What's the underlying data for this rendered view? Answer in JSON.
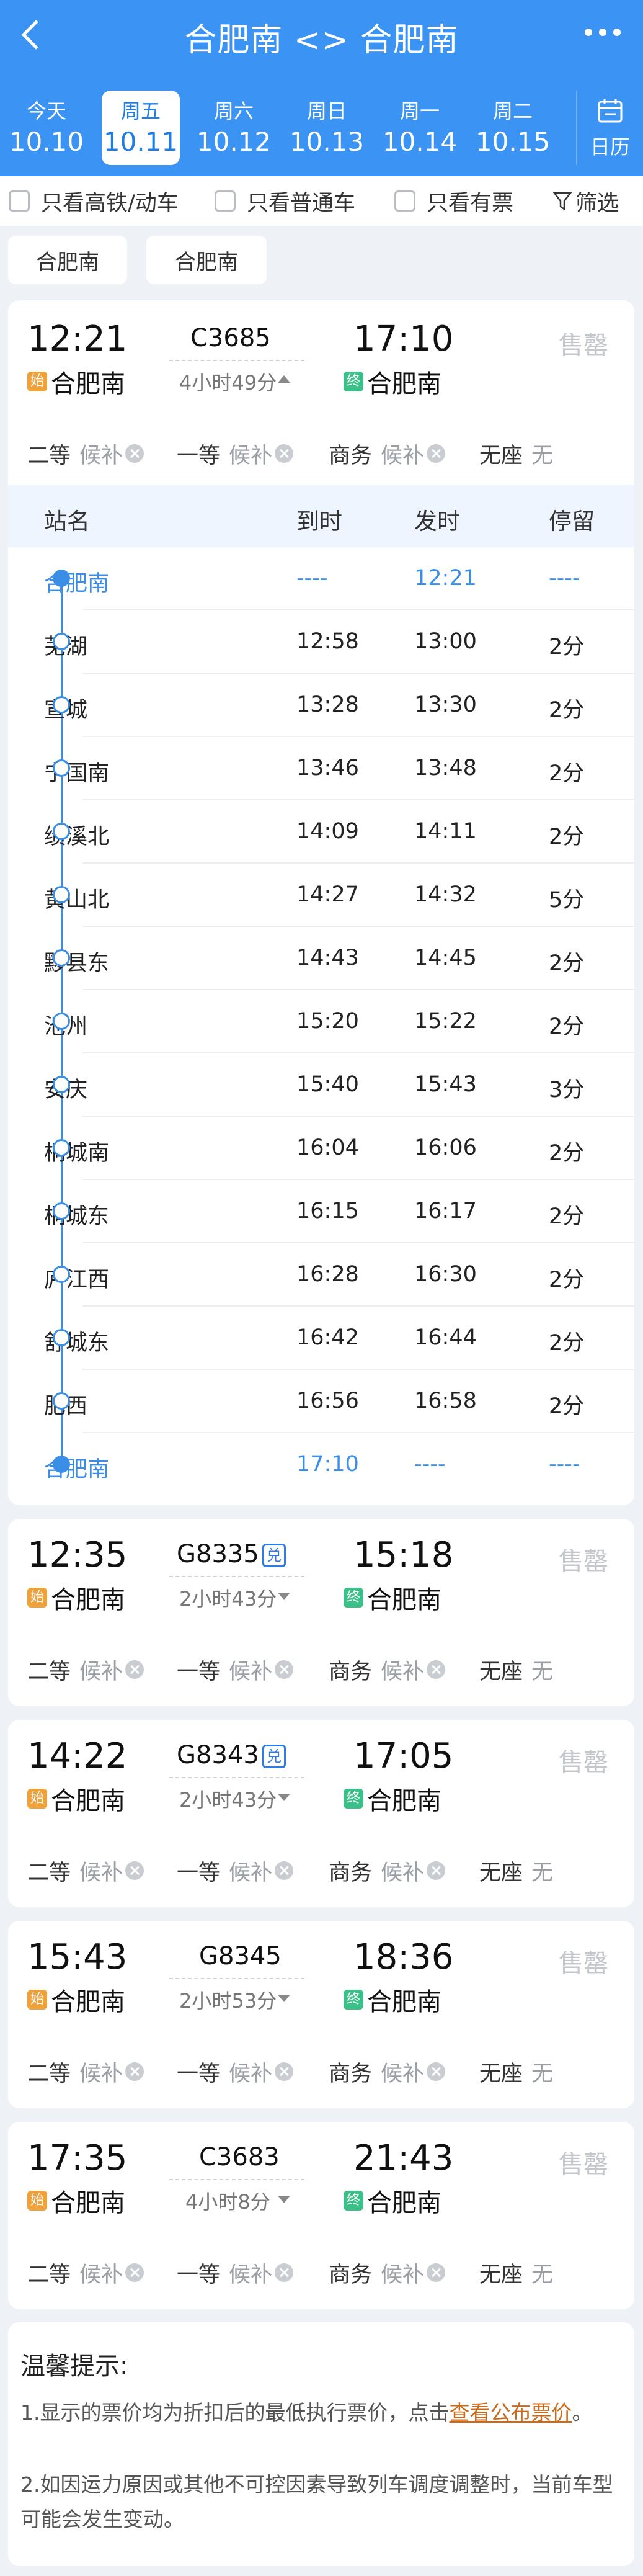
{
  "header": {
    "title": "合肥南 <> 合肥南",
    "back_icon": "chevron-left-icon",
    "more_icon": "more-dots-icon"
  },
  "dates": [
    {
      "weekday": "今天",
      "date": "10.10",
      "active": false
    },
    {
      "weekday": "周五",
      "date": "10.11",
      "active": true
    },
    {
      "weekday": "周六",
      "date": "10.12",
      "active": false
    },
    {
      "weekday": "周日",
      "date": "10.13",
      "active": false
    },
    {
      "weekday": "周一",
      "date": "10.14",
      "active": false
    },
    {
      "weekday": "周二",
      "date": "10.15",
      "active": false
    }
  ],
  "calendar": {
    "label": "日历",
    "icon": "calendar-icon"
  },
  "filters": {
    "high_speed": "只看高铁/动车",
    "regular": "只看普通车",
    "available": "只看有票",
    "filter": "筛选",
    "filter_icon": "funnel-icon"
  },
  "station_chips": {
    "from": "合肥南",
    "to": "合肥南"
  },
  "colors": {
    "primary": "#3b93f3",
    "line_blue": "#3b8ee6",
    "origin_badge": "#f0a23a",
    "terminal_badge": "#3cc08a",
    "link": "#c86a1c"
  },
  "trains": [
    {
      "dep_time": "12:21",
      "train_no": "C3685",
      "arr_time": "17:10",
      "duration": "4小时49分",
      "expand_icon": "triangle-up-icon",
      "status": "售罄",
      "from": "合肥南",
      "to": "合肥南",
      "origin_badge": "始",
      "terminal_badge": "终",
      "dui_badge": "",
      "seats": [
        {
          "class": "二等",
          "status": "候补"
        },
        {
          "class": "一等",
          "status": "候补"
        },
        {
          "class": "商务",
          "status": "候补"
        },
        {
          "class": "无座",
          "status": "无"
        }
      ]
    },
    {
      "dep_time": "12:35",
      "train_no": "G8335",
      "arr_time": "15:18",
      "duration": "2小时43分",
      "expand_icon": "triangle-down-icon",
      "status": "售罄",
      "from": "合肥南",
      "to": "合肥南",
      "origin_badge": "始",
      "terminal_badge": "终",
      "dui_badge": "兑",
      "seats": [
        {
          "class": "二等",
          "status": "候补"
        },
        {
          "class": "一等",
          "status": "候补"
        },
        {
          "class": "商务",
          "status": "候补"
        },
        {
          "class": "无座",
          "status": "无"
        }
      ]
    },
    {
      "dep_time": "14:22",
      "train_no": "G8343",
      "arr_time": "17:05",
      "duration": "2小时43分",
      "expand_icon": "triangle-down-icon",
      "status": "售罄",
      "from": "合肥南",
      "to": "合肥南",
      "origin_badge": "始",
      "terminal_badge": "终",
      "dui_badge": "兑",
      "seats": [
        {
          "class": "二等",
          "status": "候补"
        },
        {
          "class": "一等",
          "status": "候补"
        },
        {
          "class": "商务",
          "status": "候补"
        },
        {
          "class": "无座",
          "status": "无"
        }
      ]
    },
    {
      "dep_time": "15:43",
      "train_no": "G8345",
      "arr_time": "18:36",
      "duration": "2小时53分",
      "expand_icon": "triangle-down-icon",
      "status": "售罄",
      "from": "合肥南",
      "to": "合肥南",
      "origin_badge": "始",
      "terminal_badge": "终",
      "dui_badge": "",
      "seats": [
        {
          "class": "二等",
          "status": "候补"
        },
        {
          "class": "一等",
          "status": "候补"
        },
        {
          "class": "商务",
          "status": "候补"
        },
        {
          "class": "无座",
          "status": "无"
        }
      ]
    },
    {
      "dep_time": "17:35",
      "train_no": "C3683",
      "arr_time": "21:43",
      "duration": "4小时8分",
      "expand_icon": "triangle-down-icon",
      "status": "售罄",
      "from": "合肥南",
      "to": "合肥南",
      "origin_badge": "始",
      "terminal_badge": "终",
      "dui_badge": "",
      "seats": [
        {
          "class": "二等",
          "status": "候补"
        },
        {
          "class": "一等",
          "status": "候补"
        },
        {
          "class": "商务",
          "status": "候补"
        },
        {
          "class": "无座",
          "status": "无"
        }
      ]
    }
  ],
  "stop_table": {
    "headers": [
      "站名",
      "到时",
      "发时",
      "停留"
    ],
    "stops": [
      {
        "station": "合肥南",
        "arrive": "----",
        "depart": "12:21",
        "stay": "----"
      },
      {
        "station": "芜湖",
        "arrive": "12:58",
        "depart": "13:00",
        "stay": "2分"
      },
      {
        "station": "宣城",
        "arrive": "13:28",
        "depart": "13:30",
        "stay": "2分"
      },
      {
        "station": "宁国南",
        "arrive": "13:46",
        "depart": "13:48",
        "stay": "2分"
      },
      {
        "station": "绩溪北",
        "arrive": "14:09",
        "depart": "14:11",
        "stay": "2分"
      },
      {
        "station": "黄山北",
        "arrive": "14:27",
        "depart": "14:32",
        "stay": "5分"
      },
      {
        "station": "黟县东",
        "arrive": "14:43",
        "depart": "14:45",
        "stay": "2分"
      },
      {
        "station": "池州",
        "arrive": "15:20",
        "depart": "15:22",
        "stay": "2分"
      },
      {
        "station": "安庆",
        "arrive": "15:40",
        "depart": "15:43",
        "stay": "3分"
      },
      {
        "station": "桐城南",
        "arrive": "16:04",
        "depart": "16:06",
        "stay": "2分"
      },
      {
        "station": "桐城东",
        "arrive": "16:15",
        "depart": "16:17",
        "stay": "2分"
      },
      {
        "station": "庐江西",
        "arrive": "16:28",
        "depart": "16:30",
        "stay": "2分"
      },
      {
        "station": "舒城东",
        "arrive": "16:42",
        "depart": "16:44",
        "stay": "2分"
      },
      {
        "station": "肥西",
        "arrive": "16:56",
        "depart": "16:58",
        "stay": "2分"
      },
      {
        "station": "合肥南",
        "arrive": "17:10",
        "depart": "----",
        "stay": "----"
      }
    ]
  },
  "notice": {
    "title": "温馨提示:",
    "line1_prefix": "1.显示的票价均为折扣后的最低执行票价，点击",
    "line1_link": "查看公布票价",
    "line1_suffix": "。",
    "line2": "2.如因运力原因或其他不可控因素导致列车调度调整时，当前车型可能会发生变动。"
  }
}
